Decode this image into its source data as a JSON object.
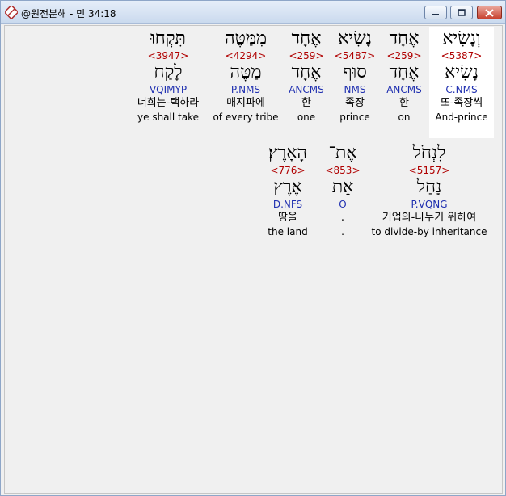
{
  "window": {
    "title": "@원전분해 - 민 34:18"
  },
  "row1": [
    {
      "heb": "וְנָשִׂיא",
      "strong": "<5387>",
      "lex": "נָשִׂיא",
      "morph": "C.NMS",
      "kor": "또-족장씩",
      "eng": "And-prince"
    },
    {
      "heb": "אֶחָד",
      "strong": "<259>",
      "lex": "אֶחָד",
      "morph": "ANCMS",
      "kor": "한",
      "eng": "on"
    },
    {
      "heb": "נָשִׂיא",
      "strong": "<5487>",
      "lex": "סוּף",
      "morph": "NMS",
      "kor": "족장",
      "eng": "prince"
    },
    {
      "heb": "אֶחָד",
      "strong": "<259>",
      "lex": "אֶחָד",
      "morph": "ANCMS",
      "kor": "한",
      "eng": "one"
    },
    {
      "heb": "מִמַּטֶּה",
      "strong": "<4294>",
      "lex": "מַטֶּה",
      "morph": "P.NMS",
      "kor": "매지파에",
      "eng": "of every tribe"
    },
    {
      "heb": "תִּקְחוּ",
      "strong": "<3947>",
      "lex": "לָקַח",
      "morph": "VQIMYP",
      "kor": "너희는-택하라",
      "eng": "ye shall take"
    }
  ],
  "row2": [
    {
      "heb": "לִנְחֹל",
      "strong": "<5157>",
      "lex": "נָחַל",
      "morph": "P.VQNG",
      "kor": "기업의-나누기 위하여",
      "eng": "to divide-by inheritance"
    },
    {
      "heb": "אֶת־",
      "strong": "<853>",
      "lex": "אֵת",
      "morph": "O",
      "kor": ".",
      "eng": "."
    },
    {
      "heb": "הָאָרֶץ׃",
      "strong": "<776>",
      "lex": "אֶרֶץ",
      "morph": "D.NFS",
      "kor": "땅을",
      "eng": "the land"
    }
  ]
}
